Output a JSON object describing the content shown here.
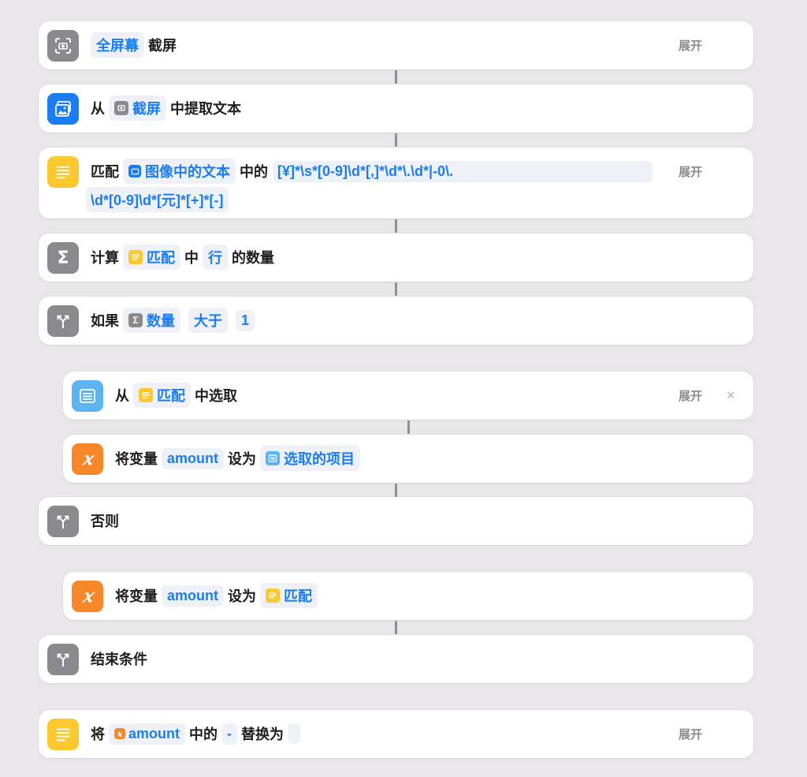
{
  "actions": {
    "screenshot": {
      "chip": "全屏幕",
      "label": "截屏",
      "expand": "展开"
    },
    "extract_text": {
      "prefix": "从",
      "chip": "截屏",
      "suffix": "中提取文本"
    },
    "match": {
      "prefix": "匹配",
      "chip": "图像中的文本",
      "middle": "中的",
      "pattern_line1": "[¥]*\\s*[0-9]\\d*[,]*\\d*\\.\\d*|-0\\.",
      "pattern_line2": "\\d*[0-9]\\d*[元]*[+]*[-]",
      "expand": "展开"
    },
    "count": {
      "prefix": "计算",
      "chip1": "匹配",
      "middle": "中",
      "chip2": "行",
      "suffix": "的数量"
    },
    "if": {
      "prefix": "如果",
      "chip1": "数量",
      "chip2": "大于",
      "chip3": "1"
    },
    "choose": {
      "prefix": "从",
      "chip": "匹配",
      "suffix": "中选取",
      "expand": "展开",
      "close": "×"
    },
    "set_var1": {
      "prefix": "将变量",
      "var": "amount",
      "middle": "设为",
      "chip": "选取的项目"
    },
    "otherwise": {
      "label": "否则"
    },
    "set_var2": {
      "prefix": "将变量",
      "var": "amount",
      "middle": "设为",
      "chip": "匹配"
    },
    "end_if": {
      "label": "结束条件"
    },
    "replace": {
      "prefix": "将",
      "chip": "amount",
      "middle": "中的",
      "chip2": "-",
      "suffix": "替换为",
      "expand": "展开"
    }
  },
  "icons": {
    "screenshot": "screenshot-icon",
    "extract_text": "image-text-icon",
    "match": "text-lines-icon",
    "count": "sigma-icon",
    "if": "branch-icon",
    "choose": "list-icon",
    "variable": "variable-x-icon",
    "replace": "text-lines-icon"
  },
  "colors": {
    "background": "#e8e6e8",
    "card": "#ffffff",
    "accent_blue": "#1c7cf4",
    "chip_bg": "#eef2f8",
    "icon_gray": "#8a8a8e",
    "icon_yellow": "#fdc72f",
    "icon_orange": "#f7882a",
    "icon_lightblue": "#5cb5f1"
  }
}
